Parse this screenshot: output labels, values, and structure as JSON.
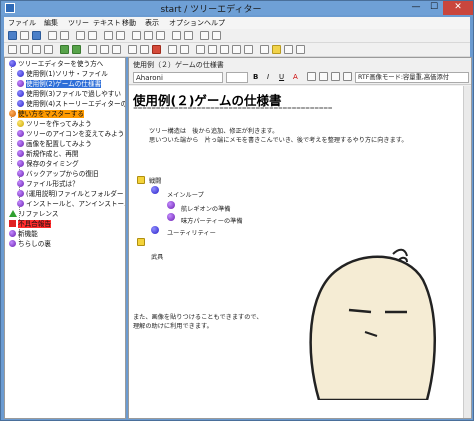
{
  "window": {
    "title": "start / ツリーエディター",
    "controls": {
      "minimize": "—",
      "maximize": "☐",
      "close": "✕"
    }
  },
  "menu": {
    "items": [
      "ファイル",
      "編集",
      "ツリー",
      "テキスト",
      "移動",
      "表示",
      "オプション",
      "ヘルプ"
    ]
  },
  "tree": {
    "items": [
      {
        "label": "ツリーエディターを使う方へ",
        "icon": "blue-ball-icon"
      },
      {
        "label": "使用例(1)ソリサ・ファイル",
        "icon": "blue-ball-icon"
      },
      {
        "label": "使用例(2)ゲームの仕様書",
        "icon": "purple-ball-icon",
        "selected": true
      },
      {
        "label": "使用例(3)ファイルで過しやすい",
        "icon": "blue-ball-icon"
      },
      {
        "label": "使用例(4)ストーリーエディターの例",
        "icon": "blue-ball-icon"
      },
      {
        "label": "使い方をマスターする",
        "icon": "orange-ball-icon",
        "highlight": "orange"
      },
      {
        "label": "ツリーを作ってみよう",
        "icon": "yellow-ball-icon"
      },
      {
        "label": "ツリーのアイコンを変えてみよう",
        "icon": "purple-ball-icon"
      },
      {
        "label": "画像を配置してみよう",
        "icon": "purple-ball-icon"
      },
      {
        "label": "新規作成と、再開",
        "icon": "purple-ball-icon"
      },
      {
        "label": "保存のタイミング",
        "icon": "purple-ball-icon"
      },
      {
        "label": "バックアップからの復旧",
        "icon": "purple-ball-icon"
      },
      {
        "label": "ファイル形式は？",
        "icon": "purple-ball-icon"
      },
      {
        "label": "(運用説明)ファイルとフォルダー",
        "icon": "purple-ball-icon"
      },
      {
        "label": "インストールと、アンインストール",
        "icon": "purple-ball-icon"
      },
      {
        "label": "リファレンス",
        "icon": "triangle-icon"
      },
      {
        "label": "不具合報告",
        "icon": "red-square-icon",
        "highlight": "red"
      },
      {
        "label": "新機能",
        "icon": "purple-ball-icon"
      },
      {
        "label": "ちらしの裏",
        "icon": "purple-ball-icon"
      }
    ]
  },
  "editor": {
    "breadcrumb": "使用例（２）ゲームの仕様書",
    "font": "Aharoni",
    "format_buttons": [
      "B",
      "I",
      "U",
      "A"
    ],
    "image_mode": "RTF画像モード:容量重,高価添付",
    "doc_title": "使用例(２)ゲームの仕様書",
    "doc_rule": "============================================",
    "lines": {
      "p1": "ツリー構造は　後から追加、修正が利きます。",
      "p2": "思いついた端から　片っ端にメモを書きこんでいき、後で考えを整理するやり方に向きます。",
      "t1": "戦闘",
      "t2": "メインループ",
      "t3": "航レギオンの準備",
      "t4": "味方パーティーの準備",
      "t5": "ユーティリティー",
      "t6": "武具",
      "p3": "また、画像を貼りつけることもできますので、",
      "p4": "理解の助けに利用できます。"
    }
  },
  "colors": {
    "title_bar": "#6fa0d6",
    "selection": "#2f6fd8",
    "orange_highlight": "#ff9a00",
    "red_highlight": "#ff2b2b"
  }
}
